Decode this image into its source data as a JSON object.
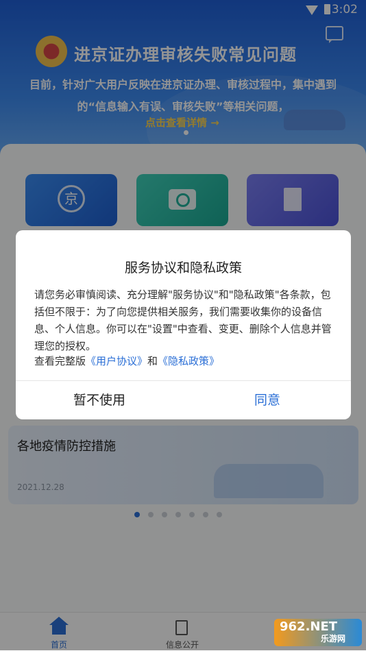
{
  "status": {
    "time": "3:02"
  },
  "banner": {
    "title": "进京证办理审核失败常见问题",
    "description": "目前，针对广大用户反映在进京证办理、审核过程中，集中遇到的“信息输入有误、审核失败”等相关问题，",
    "link": "点击查看详情 →"
  },
  "news": {
    "title": "各地疫情防控措施",
    "date": "2021.12.28"
  },
  "tabs": {
    "home": "首页",
    "info": "信息公开"
  },
  "dialog": {
    "title": "服务协议和隐私政策",
    "body": "请您务必审慎阅读、充分理解\"服务协议\"和\"隐私政策\"各条款，包括但不限于：为了向您提供相关服务，我们需要收集你的设备信息、个人信息。你可以在\"设置\"中查看、变更、删除个人信息并管理您的授权。",
    "links_prefix": "查看完整版",
    "user_agreement": "《用户协议》",
    "links_and": "和",
    "privacy_policy": "《隐私政策》",
    "decline": "暂不使用",
    "agree": "同意"
  },
  "watermark": {
    "top": "962.NET",
    "bottom": "乐游网"
  },
  "icons": [
    "message-icon",
    "police-emblem-icon",
    "jing-icon",
    "camera-icon",
    "building-icon",
    "home-icon",
    "document-icon"
  ],
  "colors": {
    "accent": "#2b6fd6",
    "banner": "#1f5fd6",
    "link_yellow": "#ffd23f"
  }
}
